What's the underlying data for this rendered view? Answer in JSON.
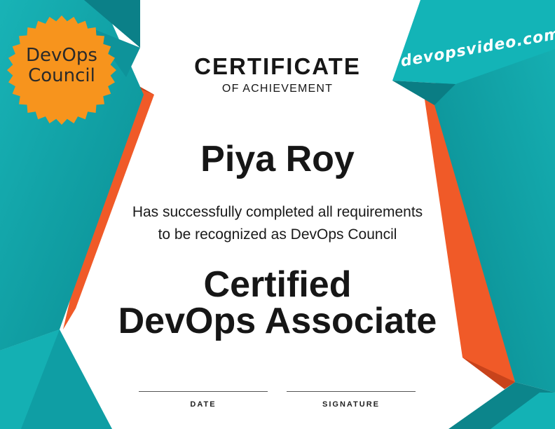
{
  "certificate": {
    "title": "CERTIFICATE",
    "subtitle": "OF ACHIEVEMENT",
    "recipient_name": "Piya Roy",
    "statement_line1": "Has successfully completed all requirements",
    "statement_line2": "to be recognized as DevOps Council",
    "credential_line1": "Certified",
    "credential_line2": "DevOps Associate"
  },
  "badge": {
    "line1": "DevOps",
    "line2": "Council",
    "color": "#f7941d"
  },
  "website": {
    "text": "devopsvideo.com"
  },
  "signatures": {
    "date_label": "DATE",
    "signature_label": "SIGNATURE"
  },
  "colors": {
    "teal": "#0d9aa0",
    "teal_dark": "#08686f",
    "teal_light": "#13b5b8",
    "orange": "#f05a28",
    "text": "#161616"
  }
}
